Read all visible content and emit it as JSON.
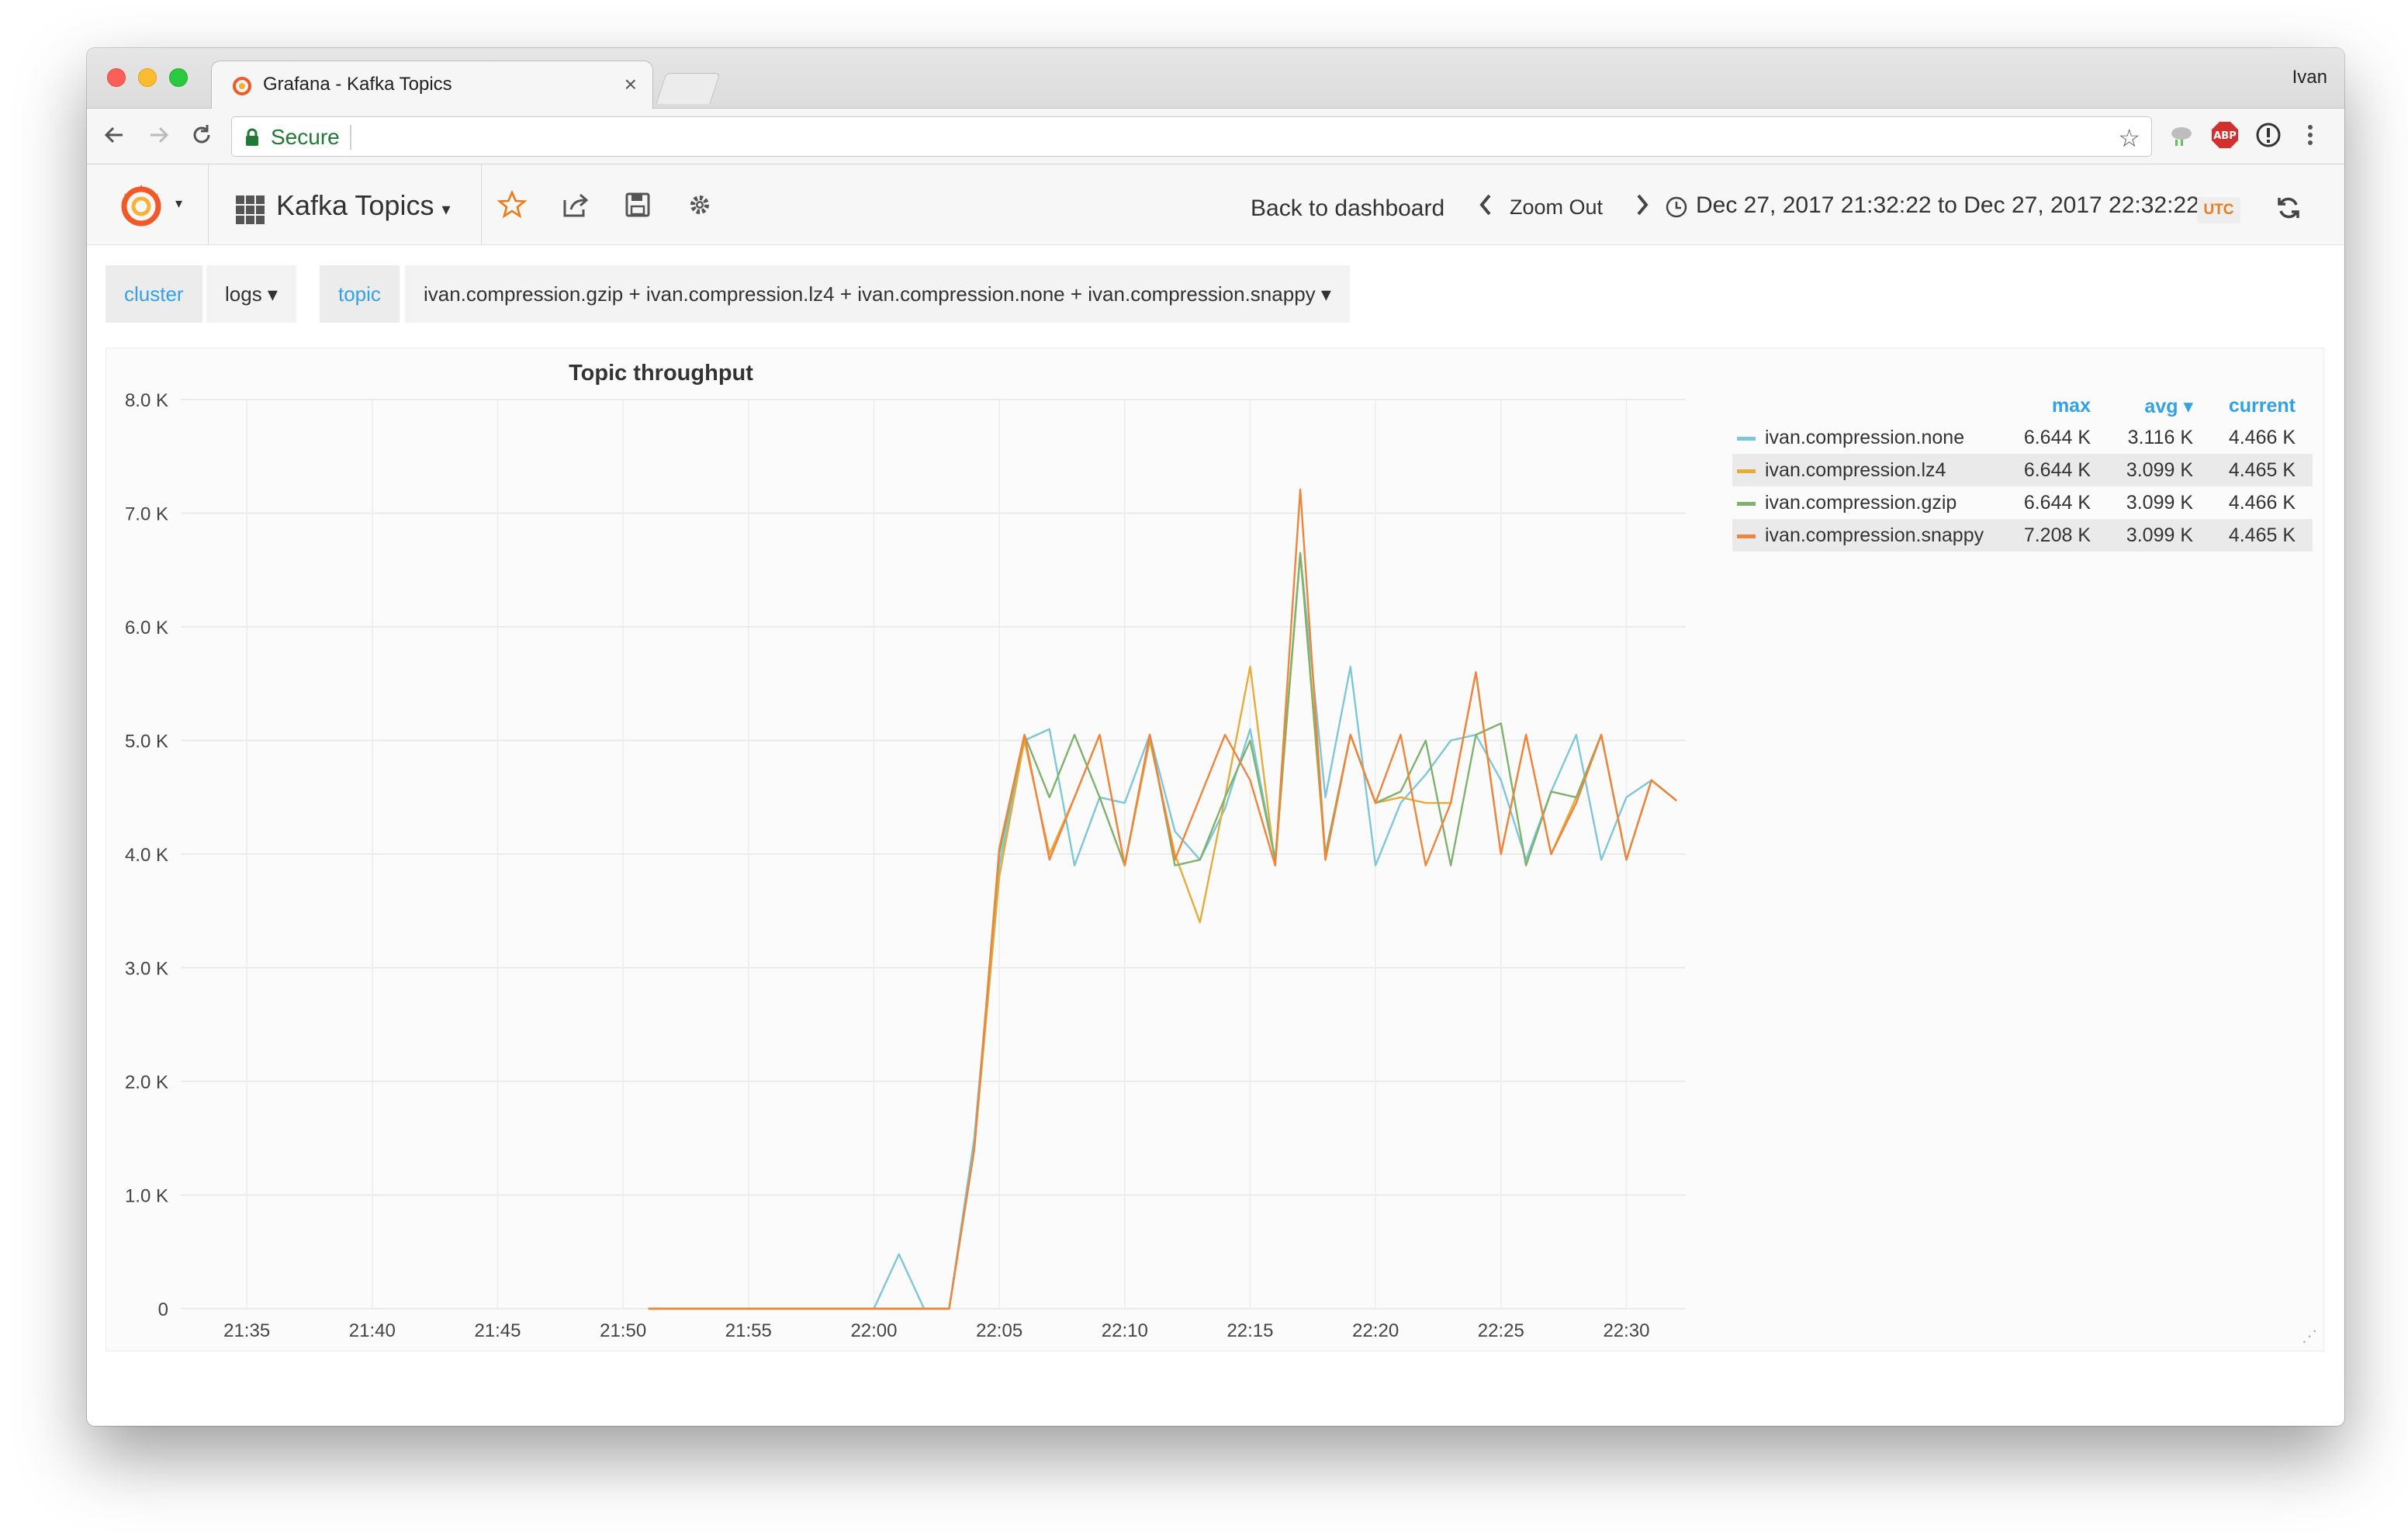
{
  "browser": {
    "tab_title": "Grafana - Kafka Topics",
    "tab_close": "×",
    "profile_name": "Ivan",
    "secure_label": "Secure",
    "extensions": [
      "cloud-extension-icon",
      "adblock-icon",
      "info-extension-icon",
      "more-menu-icon"
    ]
  },
  "grafana_nav": {
    "dashboard_title": "Kafka Topics",
    "back_to_dashboard": "Back to dashboard",
    "zoom_out": "Zoom Out",
    "time_range": "Dec 27, 2017 21:32:22 to Dec 27, 2017 22:32:22",
    "timezone_badge": "UTC"
  },
  "template_vars": [
    {
      "label": "cluster",
      "value": "logs ▾"
    },
    {
      "label": "topic",
      "value": "ivan.compression.gzip + ivan.compression.lz4 + ivan.compression.none + ivan.compression.snappy ▾"
    }
  ],
  "panel": {
    "title": "Topic throughput",
    "legend_headers": {
      "max": "max",
      "avg": "avg ▾",
      "current": "current"
    },
    "legend": [
      {
        "name": "ivan.compression.none",
        "max": "6.644 K",
        "avg": "3.116 K",
        "current": "4.466 K",
        "color": "#7ec6d9"
      },
      {
        "name": "ivan.compression.lz4",
        "max": "6.644 K",
        "avg": "3.099 K",
        "current": "4.465 K",
        "color": "#e5ac3a"
      },
      {
        "name": "ivan.compression.gzip",
        "max": "6.644 K",
        "avg": "3.099 K",
        "current": "4.466 K",
        "color": "#7eb26d"
      },
      {
        "name": "ivan.compression.snappy",
        "max": "7.208 K",
        "avg": "3.099 K",
        "current": "4.465 K",
        "color": "#ef843c"
      }
    ]
  },
  "chart_data": {
    "type": "line",
    "title": "Topic throughput",
    "xlabel": "",
    "ylabel": "",
    "ylim": [
      0,
      8000
    ],
    "y_ticks": [
      "0",
      "1.0 K",
      "2.0 K",
      "3.0 K",
      "4.0 K",
      "5.0 K",
      "6.0 K",
      "7.0 K",
      "8.0 K"
    ],
    "x_ticks": [
      "21:35",
      "21:40",
      "21:45",
      "21:50",
      "21:55",
      "22:00",
      "22:05",
      "22:10",
      "22:15",
      "22:20",
      "22:25",
      "22:30"
    ],
    "x_minutes_range": [
      21.55,
      22.54
    ],
    "grid": true,
    "legend_position": "right",
    "series": [
      {
        "name": "ivan.compression.none",
        "color": "#7ec6d9",
        "points": [
          [
            "21:51",
            0
          ],
          [
            "21:54",
            0
          ],
          [
            "21:58",
            0
          ],
          [
            "22:00",
            0
          ],
          [
            "22:01",
            480
          ],
          [
            "22:02",
            0
          ],
          [
            "22:03",
            0
          ],
          [
            "22:04",
            1500
          ],
          [
            "22:05",
            3900
          ],
          [
            "22:06",
            5000
          ],
          [
            "22:07",
            5100
          ],
          [
            "22:08",
            3900
          ],
          [
            "22:09",
            4500
          ],
          [
            "22:10",
            4450
          ],
          [
            "22:11",
            5050
          ],
          [
            "22:12",
            4200
          ],
          [
            "22:13",
            3950
          ],
          [
            "22:14",
            4400
          ],
          [
            "22:15",
            5100
          ],
          [
            "22:16",
            3950
          ],
          [
            "22:17",
            6640
          ],
          [
            "22:18",
            4500
          ],
          [
            "22:19",
            5650
          ],
          [
            "22:20",
            3900
          ],
          [
            "22:21",
            4450
          ],
          [
            "22:22",
            4700
          ],
          [
            "22:23",
            5000
          ],
          [
            "22:24",
            5050
          ],
          [
            "22:25",
            4650
          ],
          [
            "22:26",
            3950
          ],
          [
            "22:27",
            4550
          ],
          [
            "22:28",
            5050
          ],
          [
            "22:29",
            3950
          ],
          [
            "22:30",
            4500
          ],
          [
            "22:31",
            4650
          ],
          [
            "22:32",
            4470
          ]
        ]
      },
      {
        "name": "ivan.compression.lz4",
        "color": "#e5ac3a",
        "points": [
          [
            "21:51",
            0
          ],
          [
            "22:03",
            0
          ],
          [
            "22:04",
            1400
          ],
          [
            "22:05",
            3800
          ],
          [
            "22:06",
            5000
          ],
          [
            "22:07",
            4000
          ],
          [
            "22:08",
            4500
          ],
          [
            "22:09",
            5050
          ],
          [
            "22:10",
            3900
          ],
          [
            "22:11",
            5000
          ],
          [
            "22:12",
            4000
          ],
          [
            "22:13",
            3400
          ],
          [
            "22:14",
            4500
          ],
          [
            "22:15",
            5650
          ],
          [
            "22:16",
            3900
          ],
          [
            "22:17",
            6650
          ],
          [
            "22:18",
            3950
          ],
          [
            "22:19",
            5050
          ],
          [
            "22:20",
            4450
          ],
          [
            "22:21",
            4500
          ],
          [
            "22:22",
            4450
          ],
          [
            "22:23",
            4450
          ],
          [
            "22:24",
            5600
          ],
          [
            "22:25",
            4000
          ],
          [
            "22:26",
            5050
          ],
          [
            "22:27",
            4000
          ],
          [
            "22:28",
            4500
          ],
          [
            "22:29",
            5050
          ],
          [
            "22:30",
            3950
          ],
          [
            "22:31",
            4650
          ],
          [
            "22:32",
            4470
          ]
        ]
      },
      {
        "name": "ivan.compression.gzip",
        "color": "#7eb26d",
        "points": [
          [
            "21:51",
            0
          ],
          [
            "22:03",
            0
          ],
          [
            "22:04",
            1400
          ],
          [
            "22:05",
            4000
          ],
          [
            "22:06",
            5050
          ],
          [
            "22:07",
            4500
          ],
          [
            "22:08",
            5050
          ],
          [
            "22:09",
            4500
          ],
          [
            "22:10",
            3900
          ],
          [
            "22:11",
            5050
          ],
          [
            "22:12",
            3900
          ],
          [
            "22:13",
            3950
          ],
          [
            "22:14",
            4500
          ],
          [
            "22:15",
            5000
          ],
          [
            "22:16",
            3950
          ],
          [
            "22:17",
            6650
          ],
          [
            "22:18",
            4000
          ],
          [
            "22:19",
            5050
          ],
          [
            "22:20",
            4450
          ],
          [
            "22:21",
            4550
          ],
          [
            "22:22",
            5000
          ],
          [
            "22:23",
            3900
          ],
          [
            "22:24",
            5050
          ],
          [
            "22:25",
            5150
          ],
          [
            "22:26",
            3900
          ],
          [
            "22:27",
            4550
          ],
          [
            "22:28",
            4500
          ],
          [
            "22:29",
            5050
          ],
          [
            "22:30",
            3950
          ],
          [
            "22:31",
            4650
          ],
          [
            "22:32",
            4470
          ]
        ]
      },
      {
        "name": "ivan.compression.snappy",
        "color": "#ef843c",
        "points": [
          [
            "21:51",
            0
          ],
          [
            "22:03",
            0
          ],
          [
            "22:04",
            1400
          ],
          [
            "22:05",
            4050
          ],
          [
            "22:06",
            5050
          ],
          [
            "22:07",
            3950
          ],
          [
            "22:08",
            4500
          ],
          [
            "22:09",
            5050
          ],
          [
            "22:10",
            3900
          ],
          [
            "22:11",
            5050
          ],
          [
            "22:12",
            3950
          ],
          [
            "22:13",
            4500
          ],
          [
            "22:14",
            5050
          ],
          [
            "22:15",
            4650
          ],
          [
            "22:16",
            3900
          ],
          [
            "22:17",
            7208
          ],
          [
            "22:18",
            3950
          ],
          [
            "22:19",
            5050
          ],
          [
            "22:20",
            4450
          ],
          [
            "22:21",
            5050
          ],
          [
            "22:22",
            3900
          ],
          [
            "22:23",
            4450
          ],
          [
            "22:24",
            5600
          ],
          [
            "22:25",
            4000
          ],
          [
            "22:26",
            5050
          ],
          [
            "22:27",
            4000
          ],
          [
            "22:28",
            4450
          ],
          [
            "22:29",
            5050
          ],
          [
            "22:30",
            3950
          ],
          [
            "22:31",
            4650
          ],
          [
            "22:32",
            4470
          ]
        ]
      }
    ]
  }
}
